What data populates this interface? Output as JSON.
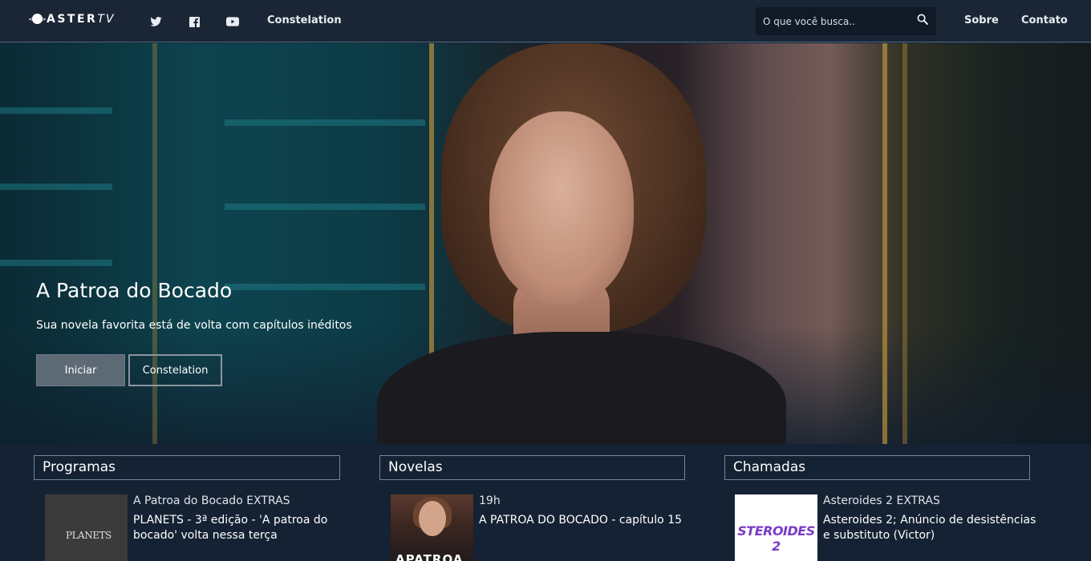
{
  "brand": {
    "name_main": "ASTER",
    "name_tv": "TV"
  },
  "nav": {
    "social": [
      {
        "name": "twitter-icon"
      },
      {
        "name": "facebook-icon"
      },
      {
        "name": "youtube-icon"
      }
    ],
    "constelation": "Constelation",
    "search_placeholder": "O que você busca..",
    "about": "Sobre",
    "contact": "Contato"
  },
  "hero": {
    "title": "A Patroa do Bocado",
    "subtitle": "Sua novela favorita está de volta com capítulos inéditos",
    "btn_primary": "Iniciar",
    "btn_secondary": "Constelation"
  },
  "sections": [
    {
      "title": "Programas",
      "card": {
        "category": "A Patroa do Bocado EXTRAS",
        "title": "PLANETS - 3ª edição - 'A patroa do bocado' volta nessa terça",
        "thumb_text": "PLANETS"
      }
    },
    {
      "title": "Novelas",
      "card": {
        "category": "19h",
        "title": "A PATROA DO BOCADO - capítulo 15",
        "thumb_text": "APATROA"
      }
    },
    {
      "title": "Chamadas",
      "card": {
        "category": "Asteroides 2 EXTRAS",
        "title": "Asteroides 2; Anúncio de desistências e substituto (Victor)",
        "thumb_text": "STEROIDES 2"
      }
    }
  ],
  "colors": {
    "navbar": "#1a2635",
    "page_bg": "#142233",
    "accent_border": "#6f879c"
  }
}
